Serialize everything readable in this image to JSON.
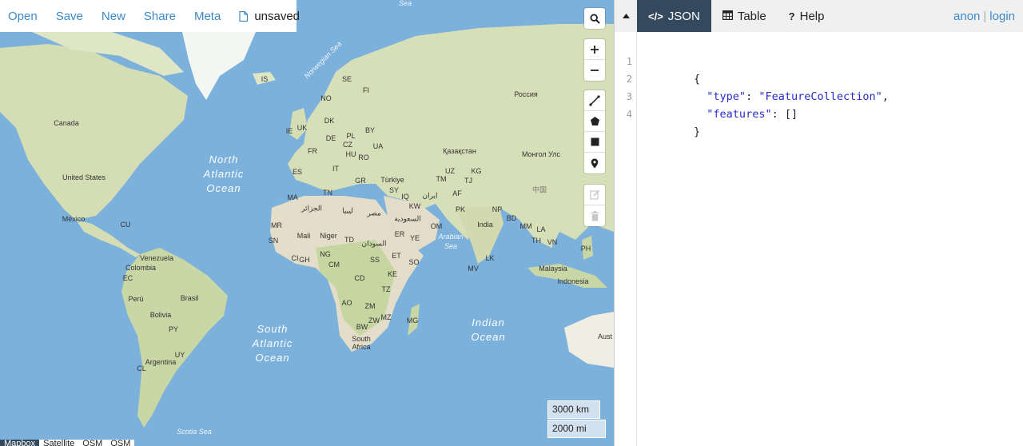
{
  "topbar": {
    "menu": [
      "Open",
      "Save",
      "New",
      "Share",
      "Meta"
    ],
    "file_status": "unsaved"
  },
  "map": {
    "scale_km": "3000 km",
    "scale_mi": "2000 mi",
    "layers": [
      "Mapbox",
      "Satellite",
      "OSM",
      "OSM"
    ],
    "active_layer": "Mapbox",
    "labels": {
      "canada": "Canada",
      "united_states": "United States",
      "mexico": "México",
      "cu": "CU",
      "venezuela": "Venezuela",
      "colombia": "Colombia",
      "ec": "EC",
      "peru": "Perú",
      "brasil": "Brasil",
      "bolivia": "Bolivia",
      "py": "PY",
      "uy": "UY",
      "argentina": "Argentina",
      "cl": "CL",
      "is": "IS",
      "no": "NO",
      "se": "SE",
      "fi": "FI",
      "dk": "DK",
      "ie": "IE",
      "uk": "UK",
      "pl": "PL",
      "by": "BY",
      "de": "DE",
      "fr": "FR",
      "cz": "CZ",
      "hu": "HU",
      "ua": "UA",
      "ro": "RO",
      "es": "ES",
      "it": "IT",
      "gr": "GR",
      "turkiye": "Türkiye",
      "rossiya": "Россия",
      "kazakhstan": "Қазақстан",
      "mongol": "Монгол Улс",
      "uz": "UZ",
      "kg": "KG",
      "tm": "TM",
      "tj": "TJ",
      "af": "AF",
      "pk": "PK",
      "iran": "ایران",
      "iq": "IQ",
      "sy": "SY",
      "kw": "KW",
      "saudi": "السعودية",
      "ye": "YE",
      "om": "OM",
      "india": "India",
      "np": "NP",
      "bd": "BD",
      "mm": "MM",
      "la": "LA",
      "th": "TH",
      "vn": "VN",
      "ph": "PH",
      "lk": "LK",
      "mv": "MV",
      "malaysia": "Malaysia",
      "indonesia": "Indonesia",
      "china": "中国",
      "ma": "MA",
      "tn": "TN",
      "algeria": "الجزائر",
      "libya": "ليبيا",
      "egypt": "مصر",
      "mr": "MR",
      "mali": "Mali",
      "niger": "Niger",
      "td": "TD",
      "sudan": "السودان",
      "er": "ER",
      "sn": "SN",
      "ci": "CI",
      "gh": "GH",
      "ng": "NG",
      "cm": "CM",
      "ss": "SS",
      "et": "ET",
      "so": "SO",
      "ke": "KE",
      "cd": "CD",
      "tz": "TZ",
      "ao": "AO",
      "zm": "ZM",
      "zw": "ZW",
      "mz": "MZ",
      "mg": "MG",
      "bw": "BW",
      "south_africa": "South Africa",
      "aust": "Aust"
    },
    "seas": {
      "north_atlantic": "North Atlantic Ocean",
      "south_atlantic": "South Atlantic Ocean",
      "indian": "Indian Ocean",
      "arabian": "Arabian Sea",
      "norwegian": "Norwegian Sea",
      "scotia": "Scotia Sea",
      "sea_top": "Sea"
    }
  },
  "tabs": [
    {
      "label": "JSON",
      "icon": "code-icon"
    },
    {
      "label": "Table",
      "icon": "table-icon"
    },
    {
      "label": "Help",
      "icon": "question-icon"
    }
  ],
  "user": {
    "anon": "anon",
    "login": "login"
  },
  "editor": {
    "line_numbers": [
      "1",
      "2",
      "3",
      "4"
    ],
    "open_brace": "{",
    "type_key": "\"type\"",
    "type_value": "\"FeatureCollection\"",
    "features_key": "\"features\"",
    "features_value": "[]",
    "close_brace": "}"
  },
  "colors": {
    "ocean": "#7cb1dc",
    "land": "#d7dfb8",
    "accent": "#3c89c7",
    "active_tab": "#34495e"
  }
}
